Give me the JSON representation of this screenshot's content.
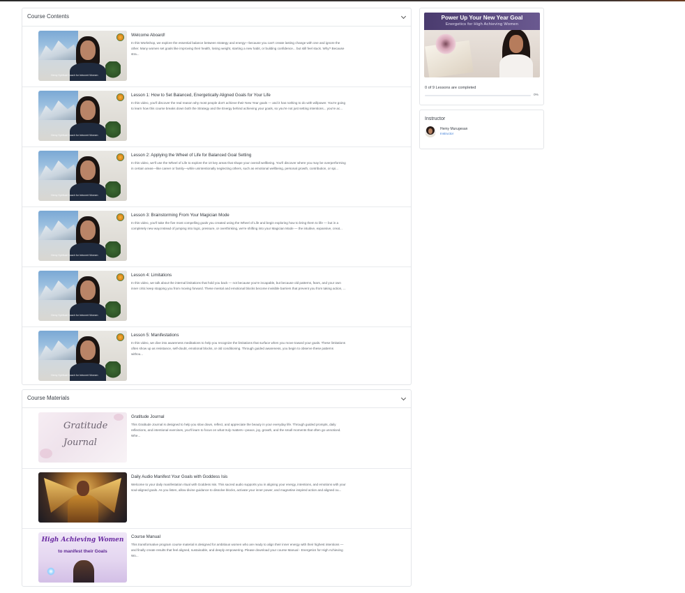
{
  "course_contents": {
    "title": "Course Contents",
    "lessons": [
      {
        "title": "Welcome Aboard!",
        "description": "In this Workshop, we explore the essential balance between strategy and energy—because you can't create lasting change with one and ignore the other. Many women set goals like improving their health, losing weight, starting a new habit, or building confidence... but still feel stuck. Why? Because stra...",
        "watermark": "Hemy Spiritual Coach for Introvert Women"
      },
      {
        "title": "Lesson 1: How to Set Balanced, Energetically Aligned Goals for Your Life",
        "description": "In this video, you'll discover the real reason why most people don't achieve their New Year goals — and it has nothing to do with willpower. You're going to learn how this course breaks down both the Strategy and the Energy behind achieving your goals, so you're not just setting intentions... you're ac...",
        "watermark": "Hemy Spiritual Coach for Introvert Women"
      },
      {
        "title": "Lesson 2: Applying the Wheel of Life for Balanced Goal Setting",
        "description": "In this video, we'll use the Wheel of Life to explore the 10 key areas that shape your overall wellbeing. You'll discover where you may be overperforming in certain areas—like career or family—while unintentionally neglecting others, such as emotional wellbeing, personal growth, contribution, or spi...",
        "watermark": "Hemy Spiritual Coach for Introvert Women"
      },
      {
        "title": "Lesson 3: Brainstorming From Your Magician Mode",
        "description": "In this video, you'll take the five most compelling goals you created using the Wheel of Life and begin exploring how to bring them to life — but in a completely new way.Instead of jumping into logic, pressure, or overthinking, we're shifting into your Magician Mode — the intuitive, expansive, creat...",
        "watermark": "Hemy Spiritual Coach for Introvert Women"
      },
      {
        "title": "Lesson 4: Limitations",
        "description": "In this video, we talk about the internal limitations that hold you back — not because you're incapable, but because old patterns, fears, and your own inner critic keep stopping you from moving forward. These mental and emotional blocks become invisible barriers that prevent you from taking action, ...",
        "watermark": "Hemy Spiritual Coach for Introvert Women"
      },
      {
        "title": "Lesson 5: Manifestations",
        "description": "In this video, we dive into awareness meditations to help you recognize the limitations that surface when you move toward your goals. These limitations often show up as resistance, self-doubt, emotional blocks, or old conditioning. Through guided awareness, you begin to observe these patterns withou...",
        "watermark": "Hemy Spiritual Coach for Introvert Women"
      }
    ]
  },
  "course_materials": {
    "title": "Course Materials",
    "items": [
      {
        "title": "Gratitude Journal",
        "description": "This Gratitude Journal is designed to help you slow down, reflect, and appreciate the beauty in your everyday life. Through guided prompts, daily reflections, and intentional exercises, you'll learn to focus on what truly matters—peace, joy, growth, and the small moments that often go unnoticed. Whe...",
        "thumb_text_1": "Gratitude",
        "thumb_text_2": "Journal"
      },
      {
        "title": "Daily Audio Manifest Your Goals with Goddess Isis",
        "description": "Welcome to your daily manifestation ritual with Goddess Isis. This sacred audio supports you in aligning your energy, intentions, and emotions with your soul-aligned goals. As you listen, allow divine guidance to dissolve blocks, activate your inner power, and magnetise inspired action and aligned ou..."
      },
      {
        "title": "Course Manual",
        "description": "This transformative program course material is designed for ambitious women who are ready to align their inner energy with their highest intentions — and finally create results that feel aligned, sustainable, and deeply empowering. Please download your course Manual - Energetics for High Achieving Wo...",
        "thumb_text_1": "High Achieving Women",
        "thumb_text_2": "to manifest their Goals"
      }
    ]
  },
  "course_card": {
    "cover_title": "Power Up Your New Year Goal",
    "cover_subtitle": "Energetics for High Achieving Women",
    "progress_text": "0 of 9 Lessons are completed",
    "progress_value": 0,
    "progress_label": "0%",
    "accent": "#3a7bd5"
  },
  "instructor": {
    "heading": "Instructor",
    "name": "Hemy Murugesan",
    "role": "Instructor"
  }
}
